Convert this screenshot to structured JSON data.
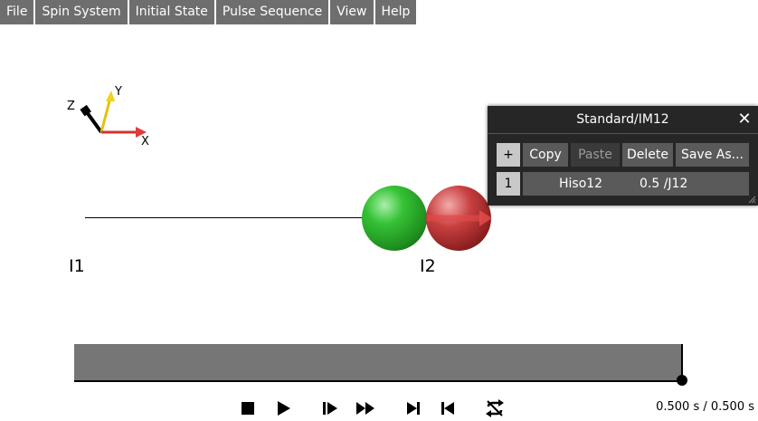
{
  "menubar": {
    "items": [
      "File",
      "Spin System",
      "Initial State",
      "Pulse Sequence",
      "View",
      "Help"
    ]
  },
  "axes": {
    "x_label": "X",
    "y_label": "Y",
    "z_label": "Z",
    "colors": {
      "x": "#e23a3a",
      "y": "#f2d21a",
      "z": "#000000"
    }
  },
  "spins": {
    "label_1": "I1",
    "label_2": "I2",
    "colors": {
      "spin_1": "#2fb02f",
      "spin_2": "#b83030"
    }
  },
  "panel": {
    "title": "Standard/IM12",
    "close_icon": "close-icon",
    "buttons": {
      "add": "+",
      "copy": "Copy",
      "paste": "Paste",
      "delete": "Delete",
      "save_as": "Save As..."
    },
    "rows": [
      {
        "index": "1",
        "name": "Hiso12",
        "duration": "0.5 /J12"
      }
    ]
  },
  "timeline": {
    "progress": 1.0
  },
  "playback": {
    "controls": [
      "stop-icon",
      "play-icon",
      "step-forward-icon",
      "fast-forward-icon",
      "skip-to-end-icon",
      "skip-to-start-icon",
      "loop-icon"
    ],
    "time_readout": "0.500 s / 0.500 s"
  }
}
